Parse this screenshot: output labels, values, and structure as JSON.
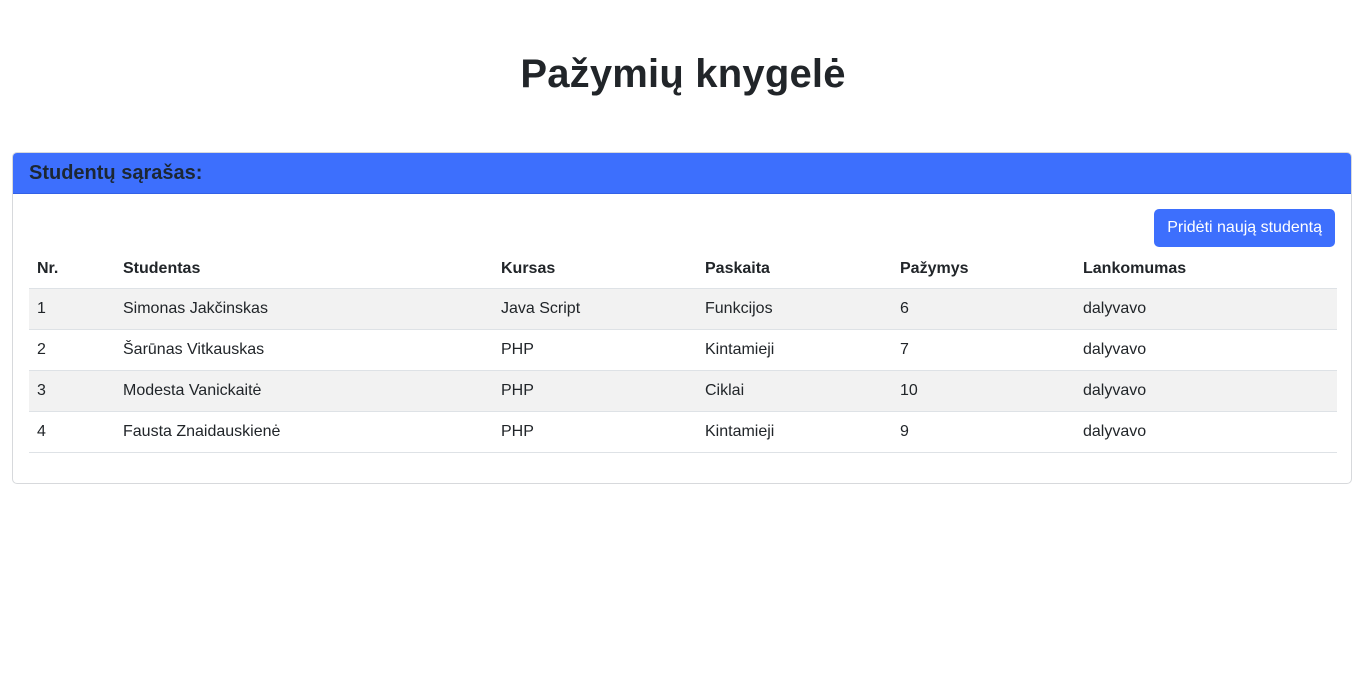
{
  "page": {
    "title": "Pažymių knygelė"
  },
  "card": {
    "header": "Studentų sąrašas:",
    "add_button_label": "Pridėti naują studentą"
  },
  "table": {
    "columns": [
      "Nr.",
      "Studentas",
      "Kursas",
      "Paskaita",
      "Pažymys",
      "Lankomumas"
    ],
    "rows": [
      [
        "1",
        "Simonas Jakčinskas",
        "Java Script",
        "Funkcijos",
        "6",
        "dalyvavo"
      ],
      [
        "2",
        "Šarūnas Vitkauskas",
        "PHP",
        "Kintamieji",
        "7",
        "dalyvavo"
      ],
      [
        "3",
        "Modesta Vanickaitė",
        "PHP",
        "Ciklai",
        "10",
        "dalyvavo"
      ],
      [
        "4",
        "Fausta Znaidauskienė",
        "PHP",
        "Kintamieji",
        "9",
        "dalyvavo"
      ]
    ]
  },
  "colors": {
    "primary": "#3d6ffd",
    "stripe": "#f2f2f2",
    "text": "#212529"
  }
}
